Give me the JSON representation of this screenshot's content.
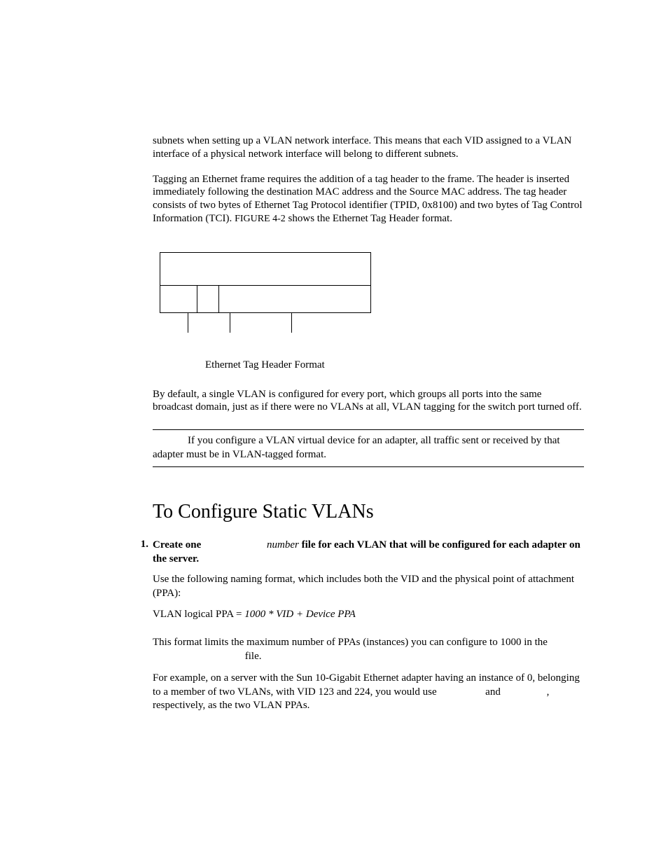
{
  "para1": "subnets when setting up a VLAN network interface. This means that each VID assigned to a VLAN interface of a physical network interface will belong to different subnets.",
  "para2_a": "Tagging an Ethernet frame requires the addition of a tag header to the frame. The header is inserted immediately following the destination MAC address and the Source MAC address. The tag header consists of two bytes of Ethernet Tag Protocol identifier (TPID, 0x8100) and two bytes of Tag Control Information (TCI). ",
  "para2_ref": "FIGURE 4-2",
  "para2_b": " shows the Ethernet Tag Header format.",
  "figure_caption": "Ethernet Tag Header Format",
  "para3": "By default, a single VLAN is configured for every port, which groups all ports into the same broadcast domain, just as if there were no VLANs at all, VLAN tagging for the switch port turned off.",
  "note": "If you configure a VLAN virtual device for an adapter, all traffic sent or received by that adapter must be in VLAN-tagged format.",
  "heading": "To Configure Static VLANs",
  "step1_num": "1.",
  "step1_a": "Create one ",
  "step1_number": "number",
  "step1_b": " file for each VLAN that will be configured for each adapter on the server.",
  "step1_sub1": "Use the following naming format, which includes both the VID and the physical point of attachment (PPA):",
  "step1_formula_a": "VLAN logical PPA = ",
  "step1_formula_b": "1000 * VID + Device PPA",
  "step1_sub2": "This format limits the maximum number of PPAs (instances) you can configure to 1000 in the ",
  "step1_sub2b": " file.",
  "step1_sub3a": "For example, on a server with the Sun 10-Gigabit Ethernet adapter having an instance of 0, belonging to a member of two VLANs, with VID 123 and 224, you would use ",
  "step1_sub3_and": " and ",
  "step1_sub3b": ", respectively, as the two VLAN PPAs."
}
